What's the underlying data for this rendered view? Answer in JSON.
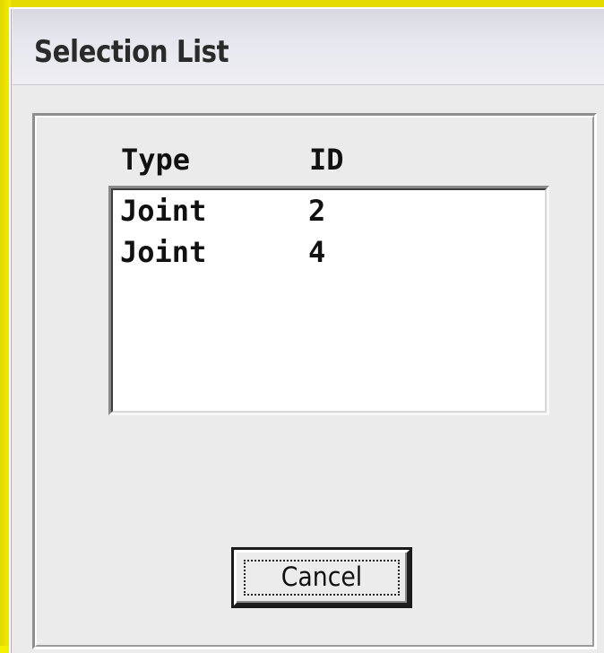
{
  "dialog": {
    "title": "Selection List"
  },
  "list": {
    "headers": {
      "type": "Type",
      "id": "ID"
    },
    "rows": [
      {
        "type": "Joint",
        "id": "2"
      },
      {
        "type": "Joint",
        "id": "4"
      }
    ]
  },
  "buttons": {
    "cancel_label": "Cancel"
  },
  "colors": {
    "background_accent": "#e6e600",
    "dialog_face": "#ececec",
    "list_background": "#ffffff"
  }
}
